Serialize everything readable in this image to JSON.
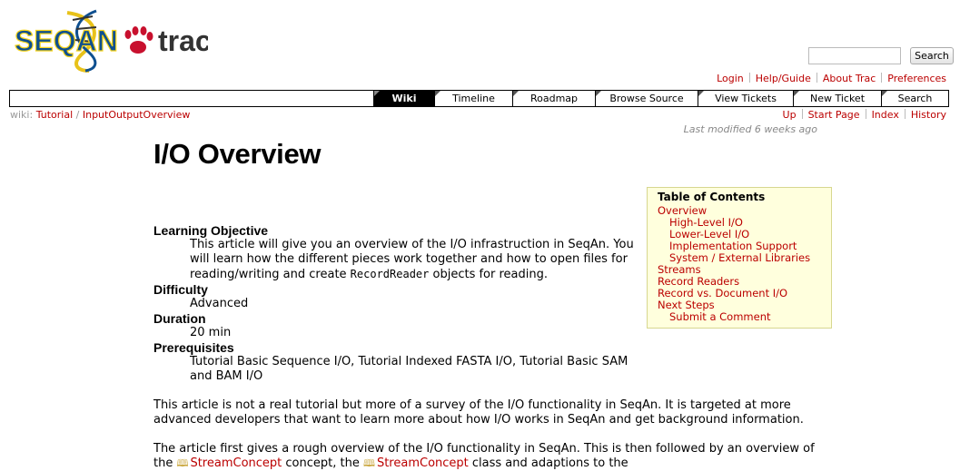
{
  "header": {
    "logo_left": "SEQAN",
    "logo_right": "trac",
    "search_placeholder": "",
    "search_button": "Search",
    "colors": {
      "logo_blue": "#0e4f8f",
      "logo_red": "#c8102e",
      "logo_yellow": "#f7d51d",
      "link": "#bb0000"
    }
  },
  "metanav": [
    "Login",
    "Help/Guide",
    "About Trac",
    "Preferences"
  ],
  "mainnav": [
    {
      "label": "Wiki",
      "active": true
    },
    {
      "label": "Timeline"
    },
    {
      "label": "Roadmap"
    },
    {
      "label": "Browse Source"
    },
    {
      "label": "View Tickets"
    },
    {
      "label": "New Ticket"
    },
    {
      "label": "Search"
    }
  ],
  "breadcrumb": {
    "prefix": "wiki:",
    "items": [
      "Tutorial",
      "/",
      "InputOutputOverview"
    ]
  },
  "ctxtnav": [
    "Up",
    "Start Page",
    "Index",
    "History"
  ],
  "last_modified": "Last modified 6 weeks ago",
  "page": {
    "title": "I/O Overview",
    "meta": [
      {
        "term": "Learning Objective",
        "desc_a": "This article will give you an overview of the I/O infrastruction in SeqAn. You will learn how the different pieces work together and how to open files for reading/writing and create ",
        "desc_code": "RecordReader",
        "desc_b": " objects for reading."
      },
      {
        "term": "Difficulty",
        "desc": "Advanced"
      },
      {
        "term": "Duration",
        "desc": "20 min"
      },
      {
        "term": "Prerequisites",
        "desc": "Tutorial Basic Sequence I/O, Tutorial Indexed FASTA I/O, Tutorial Basic SAM and BAM I/O"
      }
    ],
    "para1": "This article is not a real tutorial but more of a survey of the I/O functionality in SeqAn. It is targeted at more advanced developers that want to learn more about how I/O works in SeqAn and get background information.",
    "para2_a": "The article first gives a rough overview of the I/O functionality in SeqAn. This is then followed by an overview of the ",
    "para2_link1": "StreamConcept",
    "para2_b": " concept, the ",
    "para2_link2": "StreamConcept",
    "para2_c": " class and adaptions to the"
  },
  "toc": {
    "title": "Table of Contents",
    "items": [
      {
        "label": "Overview",
        "level": 1
      },
      {
        "label": "High-Level I/O",
        "level": 2
      },
      {
        "label": "Lower-Level I/O",
        "level": 2
      },
      {
        "label": "Implementation Support",
        "level": 2
      },
      {
        "label": "System / External Libraries",
        "level": 2
      },
      {
        "label": "Streams",
        "level": 1
      },
      {
        "label": "Record Readers",
        "level": 1
      },
      {
        "label": "Record vs. Document I/O",
        "level": 1
      },
      {
        "label": "Next Steps",
        "level": 1
      },
      {
        "label": "Submit a Comment",
        "level": 2
      }
    ]
  }
}
